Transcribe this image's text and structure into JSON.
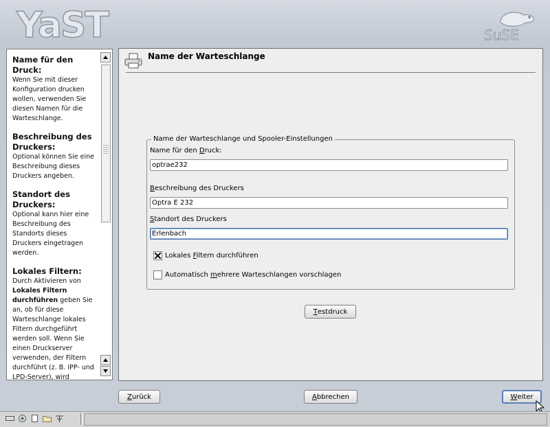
{
  "header": {
    "app_logo_text": "YaST",
    "brand_logo_text": "SuSE"
  },
  "help": {
    "sections": [
      {
        "heading": "Name für den Druck:",
        "body": "Wenn Sie mit dieser Konfiguration drucken wollen, verwenden Sie diesen Namen für die Warteschlange."
      },
      {
        "heading": "Beschreibung des Druckers:",
        "body": "Optional können Sie eine Beschreibung dieses Druckers angeben."
      },
      {
        "heading": "Standort des Druckers:",
        "body": "Optional kann hier eine Beschreibung des Standorts dieses Druckers eingetragen werden."
      },
      {
        "heading": "Lokales Filtern:",
        "body_pre": "Durch Aktivieren von ",
        "body_bold": "Lokales Filtern durchführen",
        "body_post": " geben Sie an, ob für diese Warteschlange lokales Filtern durchgeführt werden soll. Wenn Sie einen Druckserver verwenden, der Filtern durchführt (z. B. IPP- und LPD-Server), wird"
      }
    ]
  },
  "main": {
    "title": "Name der Warteschlange",
    "group_title": "Name der Warteschlange und Spooler-Einstellungen",
    "fields": {
      "queue_name": {
        "label_pre": "Name für den ",
        "label_key": "D",
        "label_post": "ruck:",
        "value": "optrae232"
      },
      "description": {
        "label_key": "B",
        "label_post": "eschreibung des Druckers",
        "value": "Optra E 232"
      },
      "location": {
        "label_key": "S",
        "label_post": "tandort des Druckers",
        "value": "Erlenbach"
      }
    },
    "checkboxes": {
      "local_filter": {
        "label_pre": "Lokales ",
        "label_key": "F",
        "label_post": "iltern durchführen",
        "checked": true
      },
      "auto_queues": {
        "label_pre": "Automatisch ",
        "label_key": "m",
        "label_post": "ehrere Warteschlangen vorschlagen",
        "checked": false
      }
    },
    "test_button": {
      "key": "T",
      "rest": "estdruck"
    }
  },
  "footer": {
    "back": {
      "key": "Z",
      "rest": "urück"
    },
    "abort": {
      "key": "A",
      "rest": "bbrechen"
    },
    "next": {
      "key": "W",
      "rest": "eiter"
    }
  },
  "colors": {
    "accent": "#5a7fb8",
    "background": "#c8ced8"
  }
}
